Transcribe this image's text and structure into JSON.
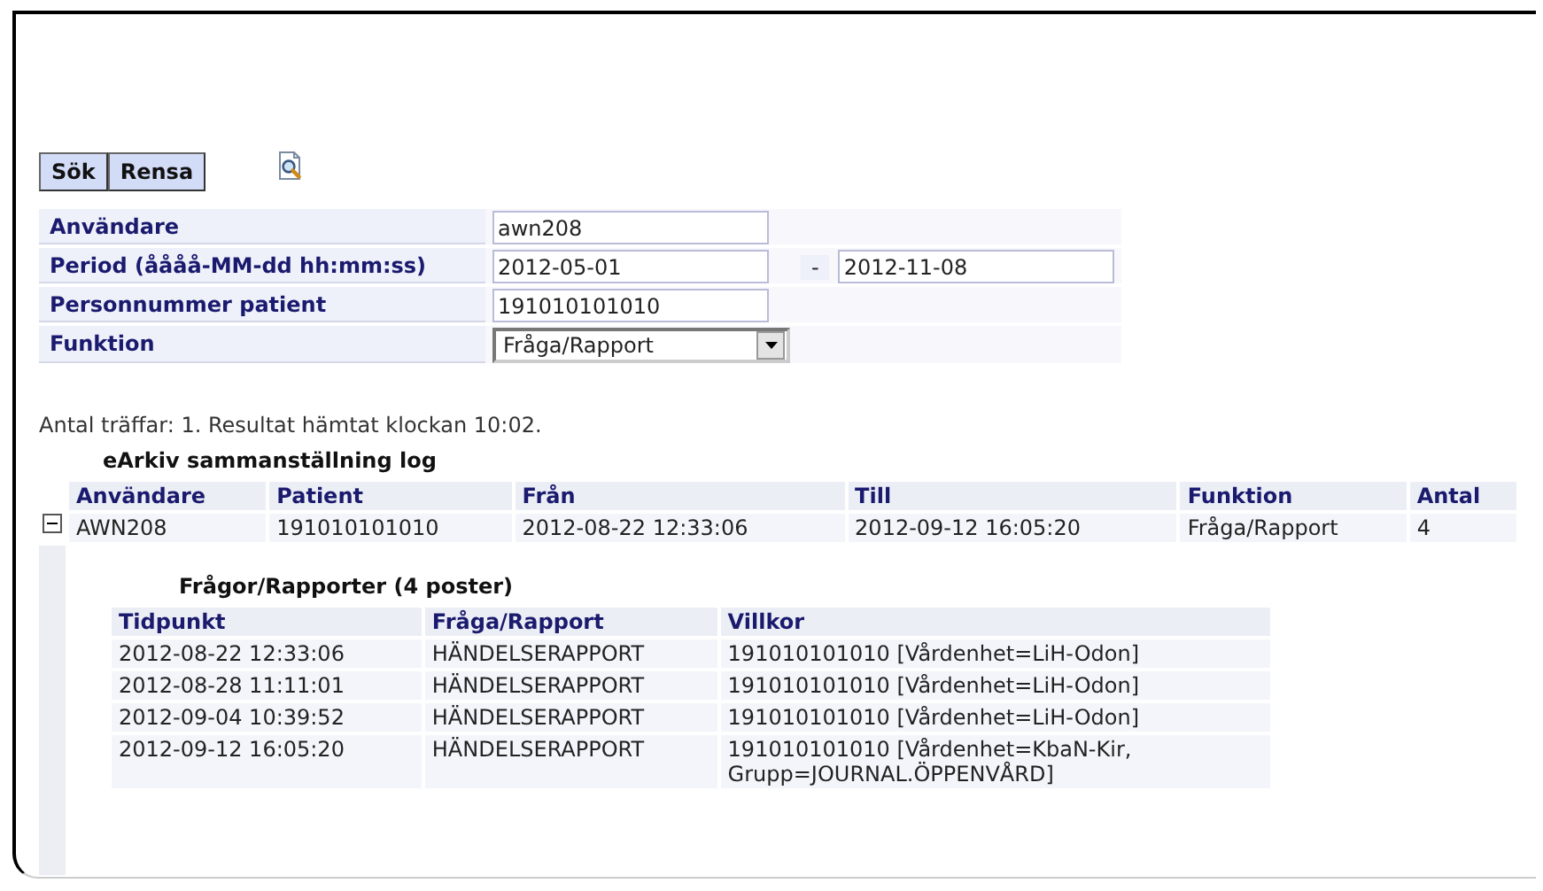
{
  "buttons": [
    "Sök",
    "Rensa"
  ],
  "form": [
    {
      "label": "Användare",
      "kind": "text",
      "value": "awn208"
    },
    {
      "label": "Period (åååå-MM-dd hh:mm:ss)",
      "kind": "range",
      "value": "2012-05-01",
      "separator": "-",
      "value_to": "2012-11-08"
    },
    {
      "label": "Personnummer patient",
      "kind": "text",
      "value": "191010101010"
    },
    {
      "label": "Funktion",
      "kind": "select",
      "value": "Fråga/Rapport"
    }
  ],
  "result_info": "Antal träffar: 1. Resultat hämtat klockan 10:02.",
  "table": {
    "caption": "eArkiv sammanställning log",
    "columns": [
      "Användare",
      "Patient",
      "Från",
      "Till",
      "Funktion",
      "Antal"
    ],
    "rows": [
      {
        "expanded": true,
        "cells": [
          "AWN208",
          "191010101010",
          "2012-08-22 12:33:06",
          "2012-09-12 16:05:20",
          "Fråga/Rapport",
          "4"
        ],
        "detail": {
          "caption": "Frågor/Rapporter (4 poster)",
          "columns": [
            "Tidpunkt",
            "Fråga/Rapport",
            "Villkor"
          ],
          "rows": [
            [
              "2012-08-22 12:33:06",
              "HÄNDELSERAPPORT",
              "191010101010 [Vårdenhet=LiH-Odon]"
            ],
            [
              "2012-08-28 11:11:01",
              "HÄNDELSERAPPORT",
              "191010101010 [Vårdenhet=LiH-Odon]"
            ],
            [
              "2012-09-04 10:39:52",
              "HÄNDELSERAPPORT",
              "191010101010 [Vårdenhet=LiH-Odon]"
            ],
            [
              "2012-09-12 16:05:20",
              "HÄNDELSERAPPORT",
              "191010101010 [Vårdenhet=KbaN-Kir,\nGrupp=JOURNAL.ÖPPENVÅRD]"
            ]
          ]
        }
      }
    ]
  }
}
